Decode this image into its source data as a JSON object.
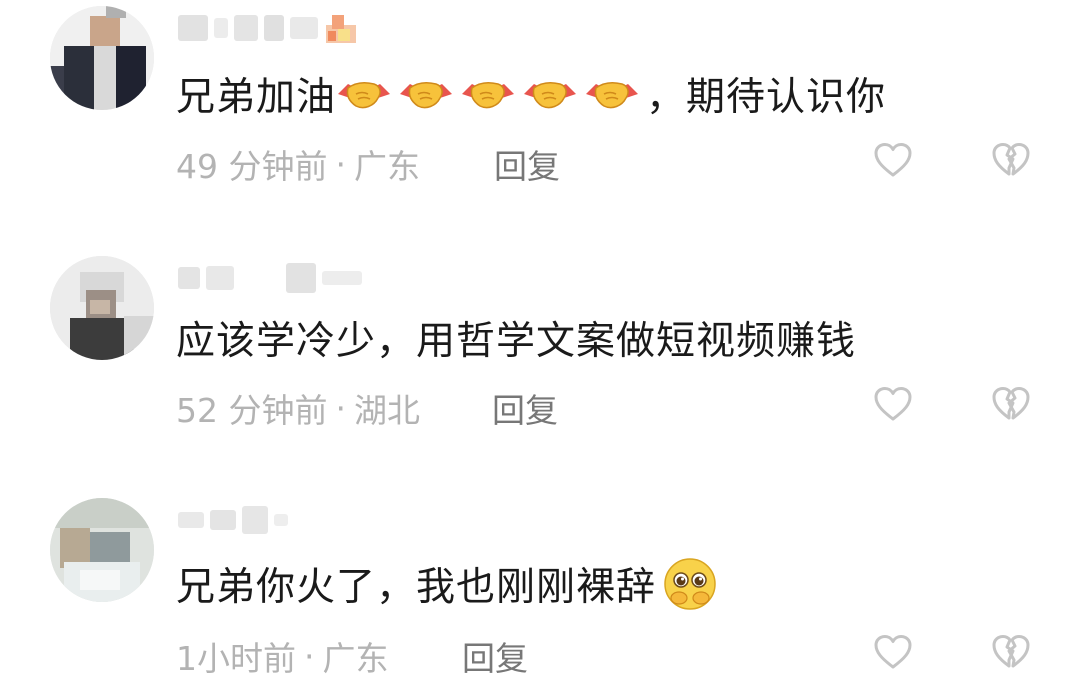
{
  "comments": [
    {
      "username": "",
      "text_before": "兄弟加油",
      "emoji": "handshake-emoji",
      "emoji_count": 5,
      "text_after": "，期待认识你",
      "time": "49 分钟前",
      "location": "广东",
      "reply_label": "回复"
    },
    {
      "username": "",
      "text_before": "应该学冷少，用哲学文案做短视频赚钱",
      "emoji": "",
      "emoji_count": 0,
      "text_after": "",
      "time": "52 分钟前",
      "location": "湖北",
      "reply_label": "回复"
    },
    {
      "username": "",
      "text_before": "兄弟你火了，我也刚刚裸辞",
      "emoji": "pleading-face-emoji",
      "emoji_count": 1,
      "text_after": "",
      "time": "1小时前",
      "location": "广东",
      "reply_label": "回复"
    }
  ],
  "colors": {
    "text": "#1a1a1a",
    "meta": "#b3b3b3",
    "reply": "#777777",
    "icon": "#c4c4c4"
  },
  "icons": [
    "heart-outline-icon",
    "broken-heart-icon"
  ],
  "separator": "·"
}
